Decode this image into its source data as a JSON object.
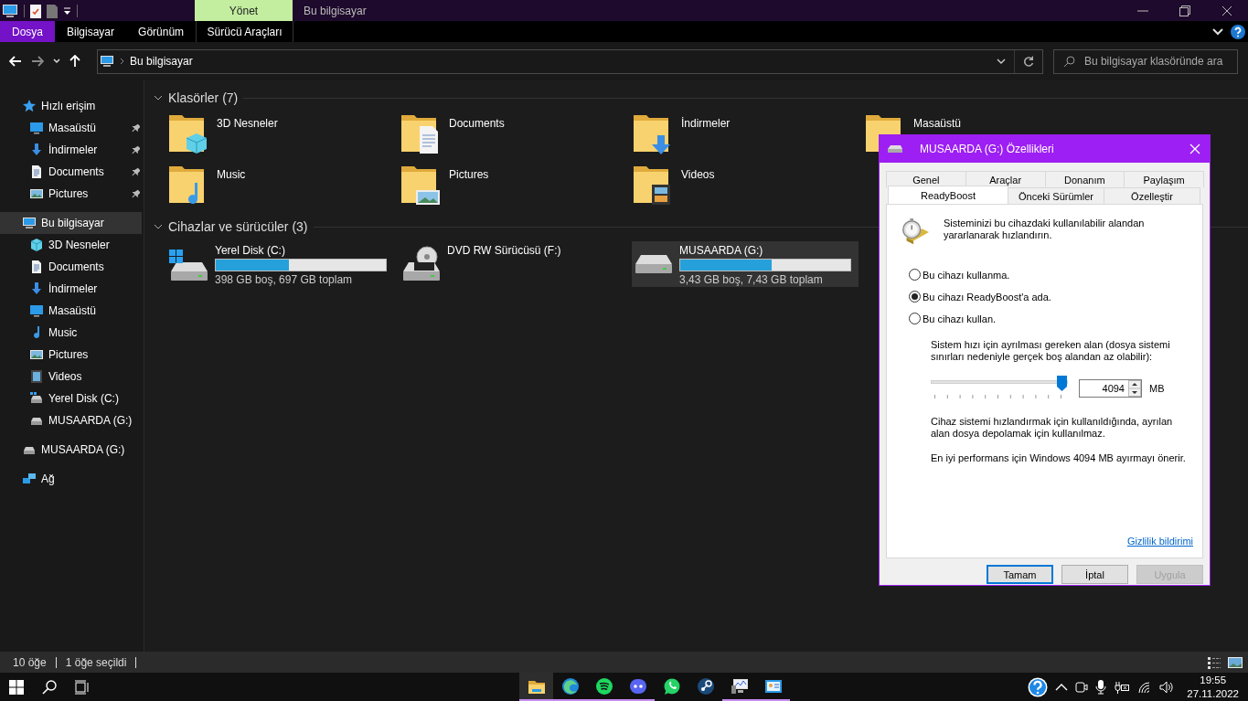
{
  "window": {
    "context_tab": "Yönet",
    "title": "Bu bilgisayar"
  },
  "ribbon_tabs": [
    {
      "label": "Dosya",
      "selected": true
    },
    {
      "label": "Bilgisayar",
      "selected": false
    },
    {
      "label": "Görünüm",
      "selected": false
    },
    {
      "label": "Sürücü Araçları",
      "selected": false
    }
  ],
  "address": {
    "path": "Bu bilgisayar"
  },
  "search": {
    "placeholder": "Bu bilgisayar klasöründe ara"
  },
  "sidebar": {
    "items": [
      {
        "label": "Hızlı erişim",
        "kind": "star",
        "selected": false,
        "children": [
          {
            "label": "Masaüstü",
            "kind": "desktop",
            "pinned": true,
            "selected": false
          },
          {
            "label": "İndirmeler",
            "kind": "downloads",
            "pinned": true,
            "selected": false
          },
          {
            "label": "Documents",
            "kind": "documents",
            "pinned": true,
            "selected": false
          },
          {
            "label": "Pictures",
            "kind": "pictures",
            "pinned": true,
            "selected": false
          }
        ]
      },
      {
        "label": "Bu bilgisayar",
        "kind": "pc",
        "selected": true,
        "children": [
          {
            "label": "3D Nesneler",
            "kind": "objects3d",
            "selected": false
          },
          {
            "label": "Documents",
            "kind": "documents",
            "selected": false
          },
          {
            "label": "İndirmeler",
            "kind": "downloads",
            "selected": false
          },
          {
            "label": "Masaüstü",
            "kind": "desktop",
            "selected": false
          },
          {
            "label": "Music",
            "kind": "music",
            "selected": false
          },
          {
            "label": "Pictures",
            "kind": "pictures",
            "selected": false
          },
          {
            "label": "Videos",
            "kind": "videos",
            "selected": false
          },
          {
            "label": "Yerel Disk (C:)",
            "kind": "windows-disk",
            "selected": false
          },
          {
            "label": "MUSAARDA (G:)",
            "kind": "usb",
            "selected": false
          }
        ]
      },
      {
        "label": "MUSAARDA (G:)",
        "kind": "usb",
        "selected": false
      },
      {
        "label": "Ağ",
        "kind": "network",
        "selected": false
      }
    ]
  },
  "groups": [
    {
      "title": "Klasörler (7)",
      "expanded": true,
      "kind": "folders",
      "items": [
        {
          "name": "3D Nesneler",
          "kind": "objects3d"
        },
        {
          "name": "Documents",
          "kind": "documents"
        },
        {
          "name": "İndirmeler",
          "kind": "downloads"
        },
        {
          "name": "Masaüstü",
          "kind": "desktop"
        },
        {
          "name": "Music",
          "kind": "music"
        },
        {
          "name": "Pictures",
          "kind": "pictures"
        },
        {
          "name": "Videos",
          "kind": "videos"
        }
      ]
    },
    {
      "title": "Cihazlar ve sürücüler (3)",
      "expanded": true,
      "kind": "drives",
      "items": [
        {
          "name": "Yerel Disk (C:)",
          "kind": "windows-disk",
          "level": 0.43,
          "detail": "398 GB boş, 697 GB toplam",
          "selected": false
        },
        {
          "name": "DVD RW Sürücüsü (F:)",
          "kind": "dvd",
          "selected": false
        },
        {
          "name": "MUSAARDA (G:)",
          "kind": "usb",
          "level": 0.54,
          "detail": "3,43 GB boş, 7,43 GB toplam",
          "selected": true
        }
      ]
    }
  ],
  "status_bar": {
    "items": [
      "10 öğe",
      "1 öğe seçildi"
    ]
  },
  "dialog": {
    "title": "MUSAARDA (G:) Özellikleri",
    "tab_rows": [
      {
        "tabs": [
          {
            "label": "Genel",
            "selected": false
          },
          {
            "label": "Araçlar",
            "selected": false
          },
          {
            "label": "Donanım",
            "selected": false
          },
          {
            "label": "Paylaşım",
            "selected": false
          }
        ]
      },
      {
        "tabs": [
          {
            "label": "ReadyBoost",
            "selected": true
          },
          {
            "label": "Önceki Sürümler",
            "selected": false
          },
          {
            "label": "Özelleştir",
            "selected": false
          }
        ]
      }
    ],
    "intro": "Sisteminizi bu cihazdaki kullanılabilir alandan yararlanarak hızlandırın.",
    "options": [
      {
        "label": "Bu cihazı kullanma.",
        "selected": false
      },
      {
        "label": "Bu cihazı ReadyBoost'a ada.",
        "selected": true
      },
      {
        "label": "Bu cihazı kullan.",
        "selected": false
      }
    ],
    "reserve_note": "Sistem hızı için ayrılması gereken alan (dosya sistemi sınırları nedeniyle gerçek boş alandan az olabilir):",
    "slider": {
      "level": 1
    },
    "amount": {
      "value": "4094",
      "unit": "MB"
    },
    "warning": "Cihaz sistemi hızlandırmak için kullanıldığında, ayrılan alan dosya depolamak için kullanılmaz.",
    "recommendation": "En iyi performans için Windows 4094 MB ayırmayı önerir.",
    "link": "Gizlilik bildirimi",
    "buttons": [
      {
        "label": "Tamam",
        "default": true,
        "disabled": false
      },
      {
        "label": "İptal",
        "default": false,
        "disabled": false
      },
      {
        "label": "Uygula",
        "default": false,
        "disabled": true
      }
    ]
  },
  "taskbar": {
    "apps": [
      {
        "kind": "explorer",
        "active": true,
        "running": true
      },
      {
        "kind": "edge",
        "active": false,
        "running": true
      },
      {
        "kind": "spotify",
        "active": false,
        "running": true
      },
      {
        "kind": "discord",
        "active": false,
        "running": true
      },
      {
        "kind": "whatsapp",
        "active": false,
        "running": false
      },
      {
        "kind": "steam",
        "active": false,
        "running": false
      },
      {
        "kind": "monitor",
        "active": false,
        "running": true
      },
      {
        "kind": "card",
        "active": false,
        "running": true
      }
    ],
    "time": "19:55",
    "date": "27.11.2022"
  }
}
